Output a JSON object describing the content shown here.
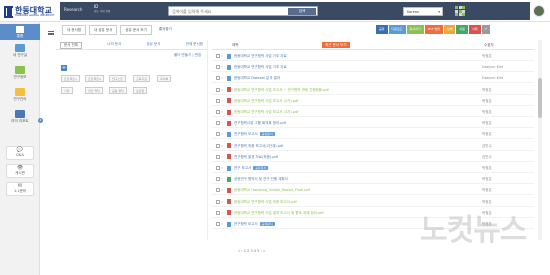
{
  "header": {
    "logo_text": "한동대학교",
    "logo_sub": "HANDONG GLOBAL UNIVERSITY",
    "portal_title": "Research",
    "user_id": "ID",
    "user_id_sub": "한동 ·대학 전체",
    "search_placeholder": "검색어를 입력해 주세요",
    "search_button": "검색",
    "language": "Korean",
    "user_name": "관리"
  },
  "sidebar": {
    "active_label": "통합",
    "items": [
      "내 연구실",
      "연구정보",
      "연구관리",
      "마이 리포트"
    ],
    "badge": "2",
    "buttons": [
      "Q&A",
      "게시판",
      "1:1문의"
    ]
  },
  "tabs": [
    "내 문서함",
    "내 공유 문서",
    "공유 문서 보기",
    "즐겨찾기"
  ],
  "action_buttons": [
    {
      "label": "공유",
      "color": "#3b6fb3"
    },
    {
      "label": "다운로드",
      "color": "#5b9bd5"
    },
    {
      "label": "복사하기",
      "color": "#8cc152"
    },
    {
      "label": "PDF 변환",
      "color": "#f26b3a"
    },
    {
      "label": "인쇄",
      "color": "#e8a93b"
    },
    {
      "label": "이동",
      "color": "#4aa56a"
    },
    {
      "label": "삭제",
      "color": "#d9534f"
    },
    {
      "label": "↺",
      "color": "#9a9a9a"
    }
  ],
  "left_panel": {
    "head": [
      "문서 전체",
      "나의 문서",
      "공유 문서",
      "전체 문서함"
    ],
    "sub": "폴더 만들기 | 편집",
    "add": "+",
    "folder_buttons": [
      "프로젝트1",
      "프로젝트2",
      "연구노트",
      "교육자료",
      "회의록",
      "기타",
      "개인 폴더",
      "공동 폴더",
      "보관함"
    ]
  },
  "table": {
    "col_title": "제목",
    "col_tag": "최근 문서 보기",
    "col_author": "수정자",
    "rows": [
      {
        "title": "한동대학교 연구협력 사업 기초 자료",
        "badge": "",
        "author": "박정은",
        "icon": "doc",
        "color": "#4a79b5"
      },
      {
        "title": "한동대학교 연구협력 사업 기초 자료",
        "badge": "",
        "author": "Daeyun Kim",
        "icon": "doc",
        "color": "#4a79b5"
      },
      {
        "title": "한동대학교 Dataset 분석 결과",
        "badge": "",
        "author": "Daeyun Kim",
        "icon": "doc",
        "color": "#4a79b5"
      },
      {
        "title": "한동대학교 연구협력 사업 보고서 ~ 연구협력 과제 진행현황.pdf",
        "badge": "",
        "author": "박정은",
        "icon": "pdf",
        "color": "#8cc152"
      },
      {
        "title": "한동대학교 연구협력 사업 보고서 (2차).pdf",
        "badge": "",
        "author": "박정은",
        "icon": "pdf",
        "color": "#8cc152"
      },
      {
        "title": "한동대학교 연구협력 사업 보고서 (3차).pdf",
        "badge": "",
        "author": "박정은",
        "icon": "pdf",
        "color": "#8cc152"
      },
      {
        "title": "연구협력사업 그룹 회의록 정리.pdf",
        "badge": "",
        "author": "박정은",
        "icon": "pdf",
        "color": "#4a79b5"
      },
      {
        "title": "연구협력 보고서",
        "badge": "공유문서",
        "author": "박정은",
        "icon": "doc",
        "color": "#4a79b5"
      },
      {
        "title": "연구협력 최종 보고서(2단계).pdf",
        "badge": "",
        "author": "김민수",
        "icon": "pdf",
        "color": "#4a79b5"
      },
      {
        "title": "연구협력 발표 자료(최종).pdf",
        "badge": "",
        "author": "김민수",
        "icon": "pdf",
        "color": "#4a79b5"
      },
      {
        "title": "연구 보고서",
        "badge": "공유문서",
        "author": "박정은",
        "icon": "doc",
        "color": "#4a79b5"
      },
      {
        "title": "공동연구 협약서 및 연구 진행 계획서",
        "badge": "",
        "author": "박정은",
        "icon": "xls",
        "color": "#4a79b5"
      },
      {
        "title": "한동대학교 Handong_Global_Report_Final.pdf",
        "badge": "",
        "author": "박정은",
        "icon": "pdf",
        "color": "#8cc152"
      },
      {
        "title": "한동대학교 연구협력 사업 최종 보고서.pdf",
        "badge": "",
        "author": "박정은",
        "icon": "pdf",
        "color": "#8cc152"
      },
      {
        "title": "한동대학교 연구협력 사업 결과 보고서 및 향후 과제 정리.pdf",
        "badge": "",
        "author": "박정은",
        "icon": "pdf",
        "color": "#8cc152"
      },
      {
        "title": "연구협력 보고서",
        "badge": "공유문서",
        "author": "박정은",
        "icon": "doc",
        "color": "#4a79b5"
      }
    ]
  },
  "pager": "« ‹ 1 2 3 4 5 › »",
  "watermark": "노컷뉴스"
}
